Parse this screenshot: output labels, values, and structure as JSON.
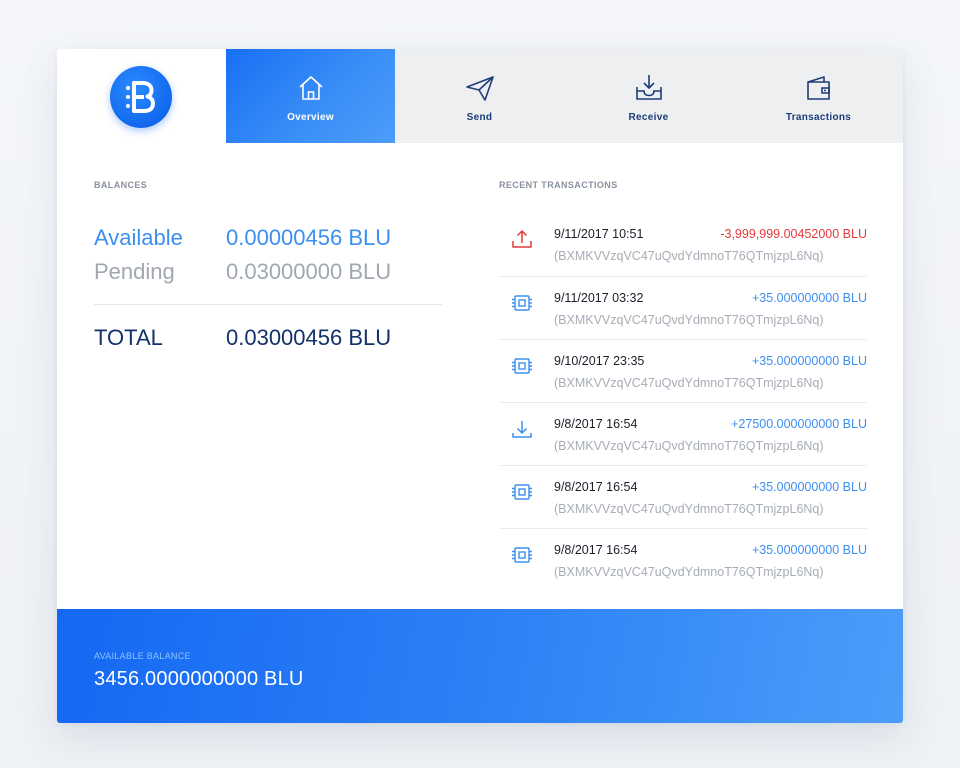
{
  "nav": {
    "tabs": [
      {
        "label": "Overview",
        "icon": "home-icon",
        "active": true
      },
      {
        "label": "Send",
        "icon": "paper-plane-icon",
        "active": false
      },
      {
        "label": "Receive",
        "icon": "inbox-download-icon",
        "active": false
      },
      {
        "label": "Transactions",
        "icon": "wallet-icon",
        "active": false
      }
    ]
  },
  "balances": {
    "title": "BALANCES",
    "available_label": "Available",
    "available_value": "0.00000456 BLU",
    "pending_label": "Pending",
    "pending_value": "0.03000000 BLU",
    "total_label": "TOTAL",
    "total_value": "0.03000456 BLU"
  },
  "transactions": {
    "title": "RECENT TRANSACTIONS",
    "items": [
      {
        "type": "sent",
        "icon": "upload-icon",
        "date": "9/11/2017 10:51",
        "amount": "-3,999,999.00452000 BLU",
        "address": "(BXMKVVzqVC47uQvdYdmnoT76QTmjzpL6Nq)"
      },
      {
        "type": "mined",
        "icon": "chip-icon",
        "date": "9/11/2017 03:32",
        "amount": "+35.000000000 BLU",
        "address": "(BXMKVVzqVC47uQvdYdmnoT76QTmjzpL6Nq)"
      },
      {
        "type": "mined",
        "icon": "chip-icon",
        "date": "9/10/2017 23:35",
        "amount": "+35.000000000 BLU",
        "address": "(BXMKVVzqVC47uQvdYdmnoT76QTmjzpL6Nq)"
      },
      {
        "type": "received",
        "icon": "download-icon",
        "date": "9/8/2017 16:54",
        "amount": "+27500.000000000 BLU",
        "address": "(BXMKVVzqVC47uQvdYdmnoT76QTmjzpL6Nq)"
      },
      {
        "type": "mined",
        "icon": "chip-icon",
        "date": "9/8/2017 16:54",
        "amount": "+35.000000000 BLU",
        "address": "(BXMKVVzqVC47uQvdYdmnoT76QTmjzpL6Nq)"
      },
      {
        "type": "mined",
        "icon": "chip-icon",
        "date": "9/8/2017 16:54",
        "amount": "+35.000000000 BLU",
        "address": "(BXMKVVzqVC47uQvdYdmnoT76QTmjzpL6Nq)"
      }
    ]
  },
  "footer": {
    "label": "AVAILABLE BALANCE",
    "value": "3456.0000000000 BLU"
  },
  "colors": {
    "brand_blue": "#1770f3",
    "accent_blue": "#3d8ff0",
    "navy": "#13316b",
    "negative_red": "#e5383b",
    "muted_gray": "#a1a7b0"
  }
}
